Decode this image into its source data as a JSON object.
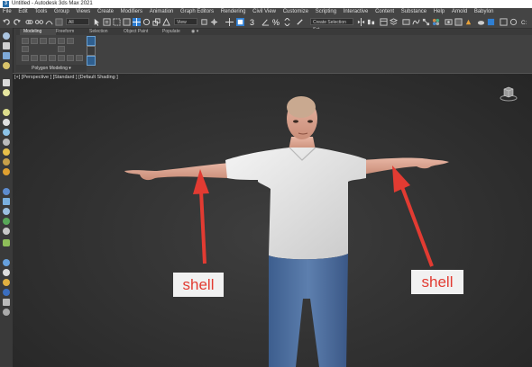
{
  "window": {
    "title": "Untitled - Autodesk 3ds Max 2021"
  },
  "menu": [
    "File",
    "Edit",
    "Tools",
    "Group",
    "Views",
    "Create",
    "Modifiers",
    "Animation",
    "Graph Editors",
    "Rendering",
    "Civil View",
    "Customize",
    "Scripting",
    "Interactive",
    "Content",
    "Substance",
    "Help",
    "Arnold",
    "Babylon"
  ],
  "toolbar": {
    "selection_filter": "All",
    "reference_coord": "View",
    "named_selection": "Create Selection Set"
  },
  "ribbon": {
    "tabs": [
      "Modeling",
      "Freeform",
      "Selection",
      "Object Paint",
      "Populate"
    ],
    "panel_label": "Polygon Modeling"
  },
  "viewport": {
    "label": "[+] [Perspective ] [Standard ] [Default Shading ]"
  },
  "annotations": [
    {
      "text": "shell"
    },
    {
      "text": "shell"
    }
  ],
  "colors": {
    "annotation": "#e23b32",
    "accent": "#2f7fd3"
  }
}
